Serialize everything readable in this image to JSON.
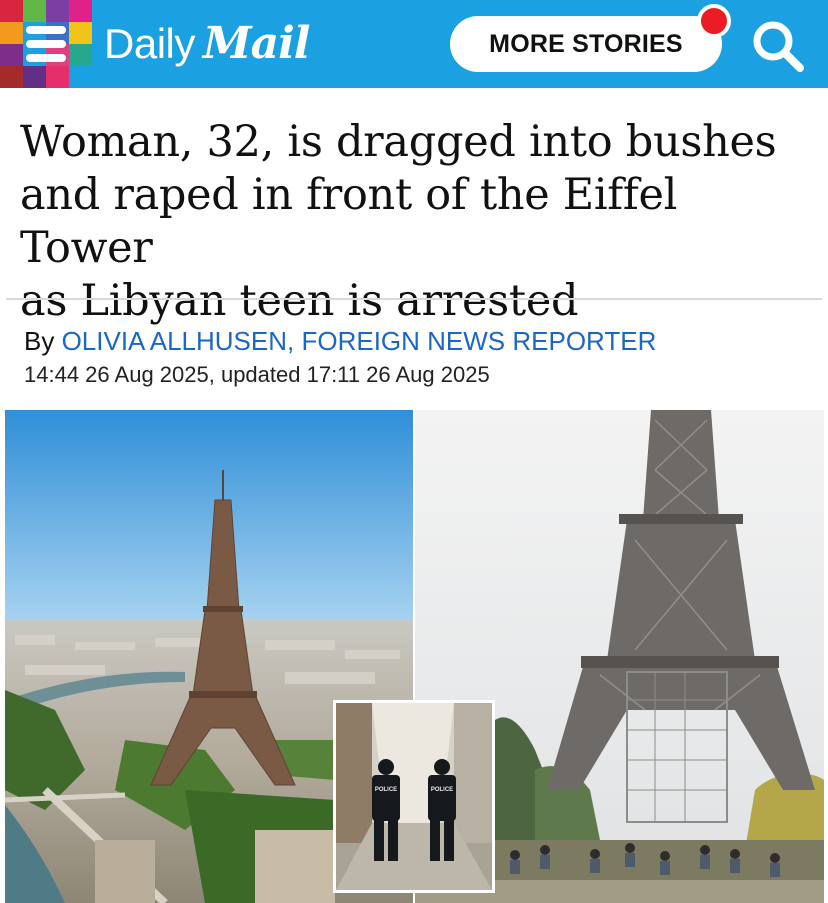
{
  "header": {
    "logo_daily": "Daily",
    "logo_mail": "Mail",
    "more_stories_label": "MORE STORIES",
    "brand_color": "#1ba1e2",
    "notification_color": "#ec1c24",
    "icons": [
      "hamburger-menu-icon",
      "search-icon",
      "notification-dot"
    ]
  },
  "article": {
    "headline_lines": [
      "Woman, 32, is dragged into bushes",
      "and raped in front of the Eiffel Tower",
      "as Libyan teen is arrested"
    ],
    "byline_prefix": "By",
    "author": "OLIVIA ALLHUSEN, FOREIGN NEWS REPORTER",
    "timestamp": "14:44 26 Aug 2025, updated 17:11 26 Aug 2025",
    "author_color": "#1b66c9"
  },
  "images": {
    "inset_badges": [
      "POLICE",
      "POLICE"
    ]
  }
}
